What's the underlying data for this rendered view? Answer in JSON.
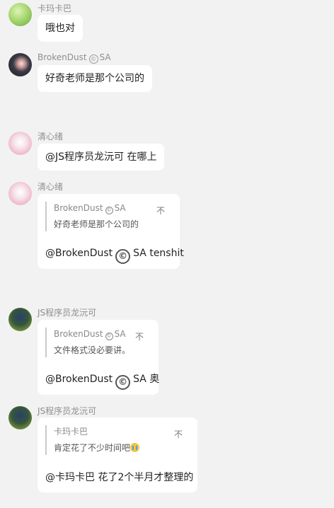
{
  "messages": [
    {
      "sender": "卡玛卡巴",
      "text": "哦也对"
    },
    {
      "sender": "BrokenDust",
      "sender_badge": "©",
      "sender_suffix": "SA",
      "text": "好奇老师是那个公司的"
    },
    {
      "sender": "清心绪",
      "text": "@JS程序员龙沅可 在哪上"
    },
    {
      "sender": "清心绪",
      "quote": {
        "name": "BrokenDust",
        "badge": "©",
        "name_suffix": "SA",
        "text": "好奇老师是那个公司的",
        "mark": "不"
      },
      "mention": "@BrokenDust",
      "mention_badge": "©",
      "reply_rest": "SA tenshit"
    },
    {
      "sender": "JS程序员龙沅可",
      "quote": {
        "name": "BrokenDust",
        "badge": "©",
        "name_suffix": "SA",
        "text": "文件格式没必要讲。",
        "mark": "不"
      },
      "mention": "@BrokenDust",
      "mention_badge": "©",
      "reply_rest": "SA 奥"
    },
    {
      "sender": "JS程序员龙沅可",
      "quote": {
        "name": "卡玛卡巴",
        "text": "肯定花了不少时间吧",
        "emoji": "crying-face",
        "mark": "不"
      },
      "reply": "@卡玛卡巴 花了2个半月才整理的"
    }
  ],
  "colors": {
    "background": "#f2f2f2",
    "bubble": "#ffffff",
    "sender_text": "#8e8e8e",
    "quote_bar": "#c9c9c9"
  }
}
